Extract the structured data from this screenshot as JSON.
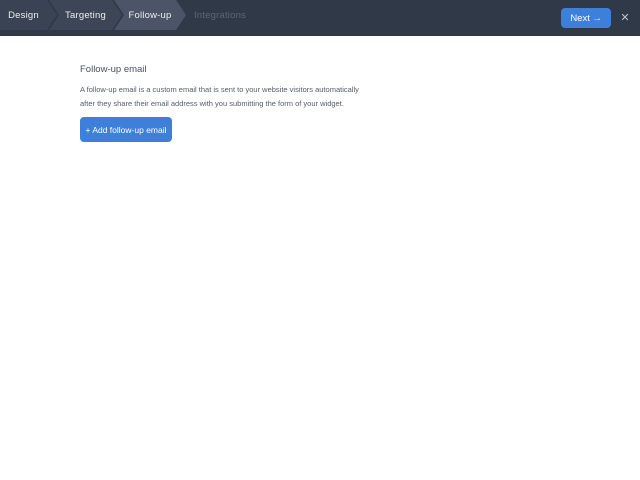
{
  "header": {
    "tabs": [
      {
        "label": "Design",
        "state": "previous"
      },
      {
        "label": "Targeting",
        "state": "previous"
      },
      {
        "label": "Follow-up",
        "state": "active"
      },
      {
        "label": "Integrations",
        "state": "disabled"
      }
    ],
    "next_button_label": "Next →",
    "close_icon": "✕"
  },
  "main": {
    "title": "Follow-up email",
    "description_lines": [
      "A follow-up email is a custom email that is sent to your website visitors automatically",
      "after they share their email address with you submitting the form of your widget."
    ],
    "add_button_label": "+ Add follow-up email"
  },
  "colors": {
    "header_bar": "#303948",
    "tab_design": "#3a4353",
    "tab_targeting": "#3d4656",
    "tab_active": "#4c5567",
    "disabled_tab_text": "#5c6676",
    "accent_blue": "#3d7fd9",
    "content_background": "#ffffff"
  }
}
